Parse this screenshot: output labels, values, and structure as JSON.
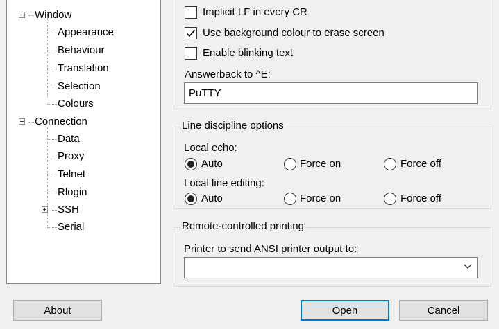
{
  "tree": {
    "window": {
      "label": "Window",
      "children": [
        "Appearance",
        "Behaviour",
        "Translation",
        "Selection",
        "Colours"
      ]
    },
    "connection": {
      "label": "Connection",
      "children": [
        "Data",
        "Proxy",
        "Telnet",
        "Rlogin",
        "SSH",
        "Serial"
      ]
    }
  },
  "terminal_options": {
    "implicit_lf": {
      "label": "Implicit LF in every CR",
      "checked": false
    },
    "use_bg_colour": {
      "label": "Use background colour to erase screen",
      "checked": true
    },
    "blinking_text": {
      "label": "Enable blinking text",
      "checked": false
    },
    "answerback": {
      "label": "Answerback to ^E:",
      "value": "PuTTY"
    }
  },
  "line_discipline": {
    "title": "Line discipline options",
    "local_echo": {
      "label": "Local echo:",
      "options": [
        "Auto",
        "Force on",
        "Force off"
      ],
      "selected": "Auto"
    },
    "local_line_editing": {
      "label": "Local line editing:",
      "options": [
        "Auto",
        "Force on",
        "Force off"
      ],
      "selected": "Auto"
    }
  },
  "printing": {
    "title": "Remote-controlled printing",
    "printer_label": "Printer to send ANSI printer output to:",
    "printer_value": ""
  },
  "buttons": {
    "about": "About",
    "open": "Open",
    "cancel": "Cancel"
  }
}
